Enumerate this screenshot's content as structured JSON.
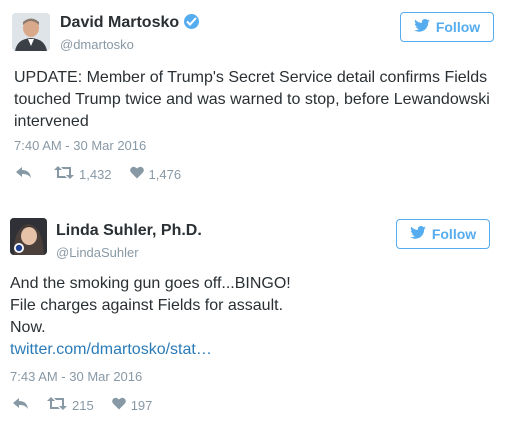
{
  "tweets": [
    {
      "name": "David Martosko",
      "handle": "@dmartosko",
      "verified": true,
      "follow_label": "Follow",
      "text_lines": [
        "UPDATE: Member of Trump's Secret Service detail confirms Fields",
        "touched Trump twice and was warned to stop, before Lewandowski",
        "intervened"
      ],
      "timestamp": "7:40 AM - 30 Mar 2016",
      "retweets": "1,432",
      "likes": "1,476"
    },
    {
      "name": "Linda Suhler, Ph.D.",
      "handle": "@LindaSuhler",
      "verified": false,
      "follow_label": "Follow",
      "text_lines": [
        "And the smoking gun goes off...BINGO!",
        "File charges against Fields for assault.",
        "Now."
      ],
      "link": "twitter.com/dmartosko/stat…",
      "timestamp": "7:43 AM - 30 Mar 2016",
      "retweets": "215",
      "likes": "197"
    }
  ],
  "colors": {
    "accent": "#55acee",
    "muted": "#8899a6",
    "link": "#2b7bb9",
    "text": "#292f33"
  },
  "icons": [
    "twitter-bird-icon",
    "verified-badge-icon",
    "reply-icon",
    "retweet-icon",
    "heart-icon"
  ]
}
